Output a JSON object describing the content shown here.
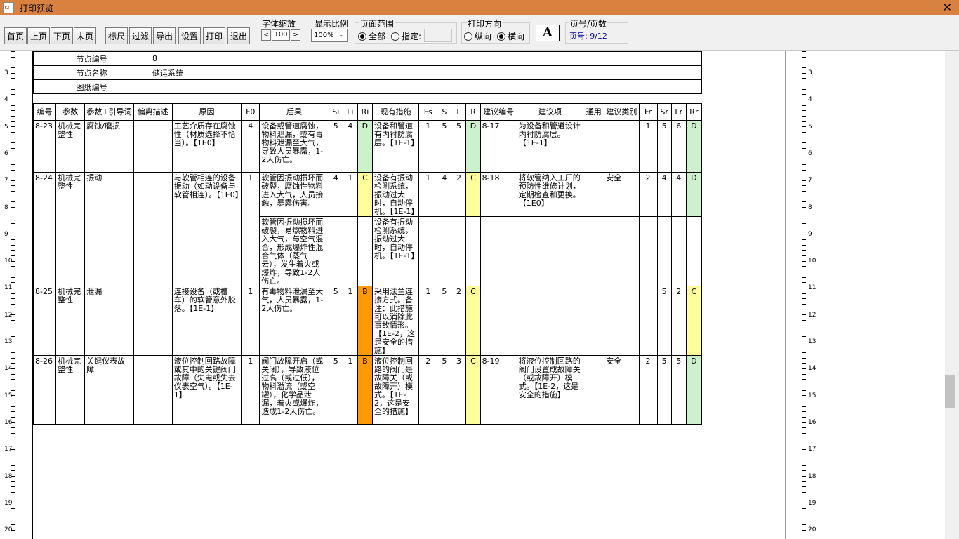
{
  "window": {
    "title": "打印预览",
    "icon_text": "KIT"
  },
  "toolbar": {
    "nav_buttons": [
      "首页",
      "上页",
      "下页",
      "末页"
    ],
    "action_buttons": [
      "标尺",
      "过滤",
      "导出",
      "设置",
      "打印",
      "退出"
    ],
    "font_zoom": {
      "label": "字体缩放",
      "value": "100",
      "dec": "<",
      "inc": ">"
    },
    "display_ratio": {
      "label": "显示比例",
      "value": "100%"
    },
    "page_range": {
      "label": "页面范围",
      "all": "全部",
      "specify": "指定:",
      "selected": "all"
    },
    "orientation": {
      "label": "打印方向",
      "portrait": "纵向",
      "landscape": "横向",
      "selected": "landscape"
    },
    "font_button": "A",
    "page_info": {
      "label": "页号/页数",
      "text": "页号:  9/12"
    }
  },
  "ruler": {
    "left_numbers": [
      "3",
      "4",
      "5",
      "6",
      "7",
      "8",
      "9",
      "10",
      "11",
      "12",
      "13",
      "14",
      "15",
      "16",
      "17",
      "18",
      "19",
      "20"
    ],
    "right_numbers": [
      "3",
      "4",
      "5",
      "6",
      "7",
      "8",
      "9",
      "10",
      "11",
      "12",
      "13",
      "14",
      "15",
      "16",
      "17",
      "18",
      "19",
      "20"
    ]
  },
  "node": {
    "number_label": "节点编号",
    "number_value": "8",
    "name_label": "节点名称",
    "name_value": "储运系统",
    "drawing_label": "图纸编号",
    "drawing_value": ""
  },
  "columns": [
    "编号",
    "参数",
    "参数+引导词",
    "偏离描述",
    "原因",
    "F0",
    "后果",
    "Si",
    "Li",
    "Ri",
    "现有措施",
    "Fs",
    "S",
    "L",
    "R",
    "建议编号",
    "建议项",
    "通用",
    "建议类别",
    "Fr",
    "Sr",
    "Lr",
    "Rr"
  ],
  "rows": [
    {
      "id": "8-23",
      "param": "机械完整性",
      "guide": "腐蚀/磨损",
      "desc": "",
      "cause": "工艺介质存在腐蚀性（材质选择不恰当）。【1E0】",
      "f0": "4",
      "consequences": [
        {
          "text": "设备或管道腐蚀，物料泄漏，或有毒物料泄漏至大气，导致人员暴露，1-2人伤亡。",
          "si": "5",
          "li": "4",
          "ri": "D",
          "measure": "设备和管道有内衬防腐层。【1E-1】",
          "fs": "1",
          "s": "5",
          "l": "5",
          "r": "D",
          "rec_id": "8-17",
          "rec": "为设备和管道设计内衬防腐层。【1E-1】",
          "general": "",
          "rec_type": "",
          "fr": "1",
          "sr": "5",
          "lr": "6",
          "rr": "D"
        }
      ]
    },
    {
      "id": "8-24",
      "param": "机械完整性",
      "guide": "振动",
      "desc": "",
      "cause": "与软管相连的设备振动（如动设备与软管相连）。【1E0】",
      "f0": "1",
      "consequences": [
        {
          "text": "软管因振动损坏而破裂，腐蚀性物料进入大气，人员接触，暴露伤害。",
          "si": "4",
          "li": "1",
          "ri": "C",
          "measure": "设备有振动检测系统，振动过大时，自动停机。【1E-1】",
          "fs": "1",
          "s": "4",
          "l": "2",
          "r": "C",
          "rec_id": "8-18",
          "rec": "将软管纳入工厂的预防性维修计划，定期检查和更换。【1E0】",
          "general": "",
          "rec_type": "安全",
          "fr": "2",
          "sr": "4",
          "lr": "4",
          "rr": "D"
        },
        {
          "text": "软管因振动损坏而破裂，易燃物料进入大气，与空气混合，形成爆炸性混合气体（蒸气云），发生着火或爆炸，导致1-2人伤亡。",
          "si": "",
          "li": "",
          "ri": "",
          "measure": "设备有振动检测系统，振动过大时，自动停机。【1E-1】",
          "fs": "",
          "s": "",
          "l": "",
          "r": "",
          "rec_id": "",
          "rec": "",
          "general": "",
          "rec_type": "",
          "fr": "",
          "sr": "",
          "lr": "",
          "rr": ""
        }
      ]
    },
    {
      "id": "8-25",
      "param": "机械完整性",
      "guide": "泄漏",
      "desc": "",
      "cause": "连接设备（或槽车）的软管意外脱落。【1E-1】",
      "f0": "1",
      "consequences": [
        {
          "text": "有毒物料泄漏至大气，人员暴露，1-2人伤亡。",
          "si": "5",
          "li": "1",
          "ri": "B",
          "measure": "采用法兰连接方式。备注：此措施可以消除此事故情形。【1E-2，这是安全的措施】",
          "fs": "1",
          "s": "5",
          "l": "2",
          "r": "C",
          "rec_id": "",
          "rec": "",
          "general": "",
          "rec_type": "",
          "fr": "",
          "sr": "5",
          "lr": "2",
          "rr": "C"
        }
      ]
    },
    {
      "id": "8-26",
      "param": "机械完整性",
      "guide": "关键仪表故障",
      "desc": "",
      "cause": "液位控制回路故障或其中的关键阀门故障（失电或失去仪表空气）。【1E-1】",
      "f0": "1",
      "consequences": [
        {
          "text": "阀门故障开启（或关闭），导致液位过高（或过低），物料溢流（或空罐），化学品泄漏，着火或爆炸，造成1-2人伤亡。",
          "si": "5",
          "li": "1",
          "ri": "B",
          "measure": "液位控制回路的阀门是故障关（或故障开）模式。【1E-2，这是安全的措施】",
          "fs": "2",
          "s": "5",
          "l": "3",
          "r": "C",
          "rec_id": "8-19",
          "rec": "将液位控制回路的阀门设置成故障关（或故障开）模式。【1E-2，这是安全的措施】",
          "general": "",
          "rec_type": "安全",
          "fr": "2",
          "sr": "5",
          "lr": "5",
          "rr": "D"
        }
      ]
    }
  ]
}
